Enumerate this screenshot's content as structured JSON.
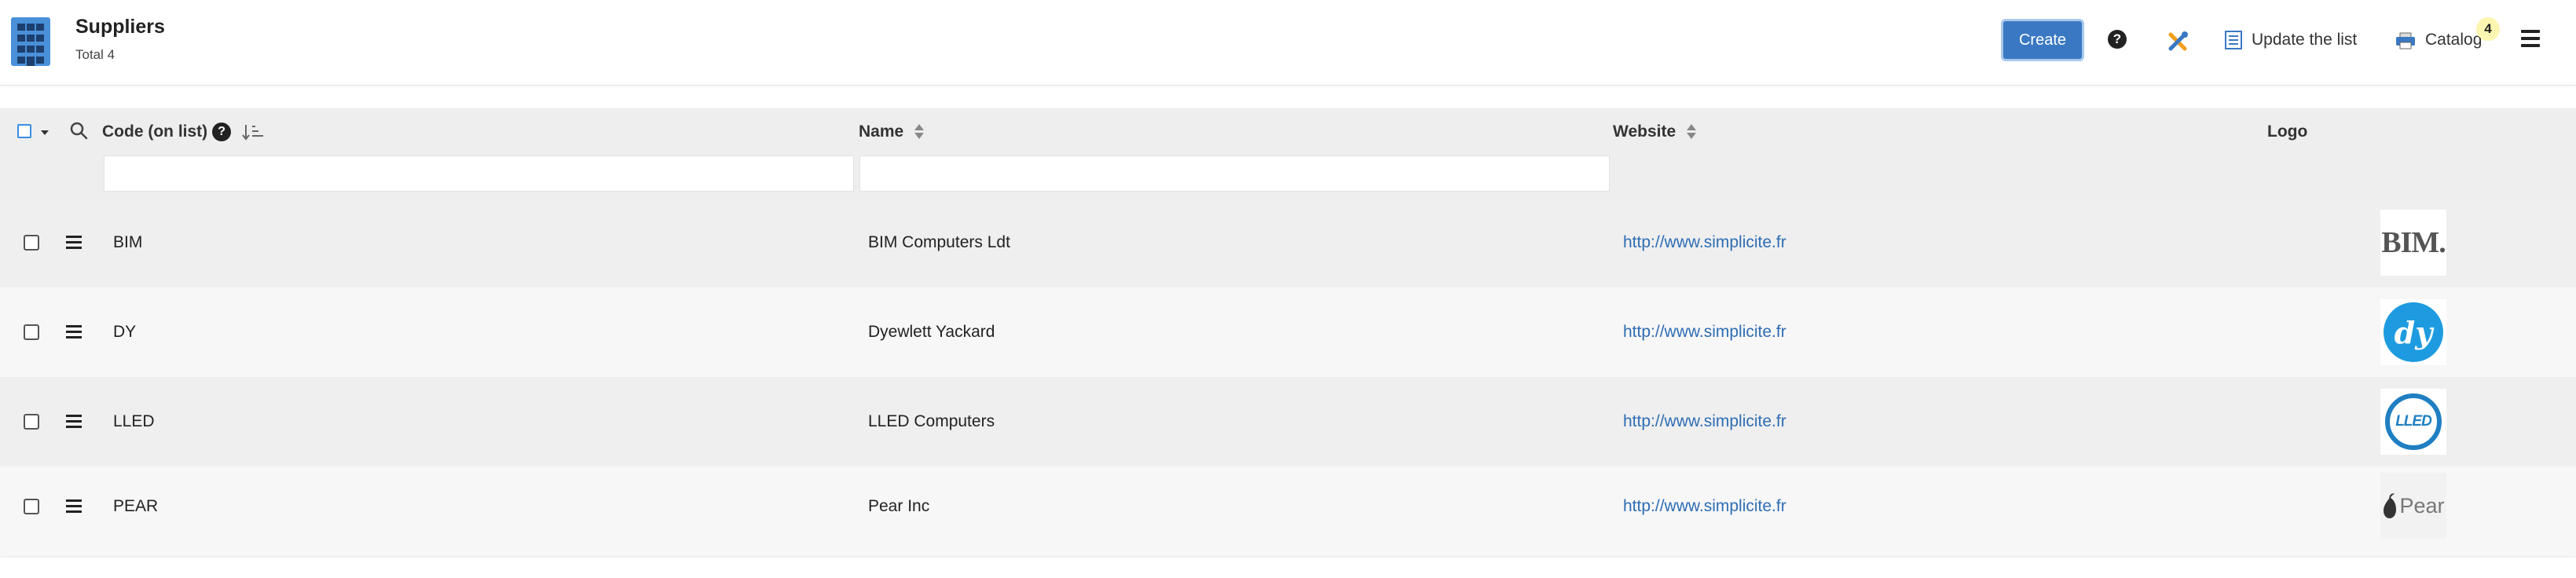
{
  "header": {
    "title": "Suppliers",
    "subtitle": "Total 4",
    "create_label": "Create",
    "help_label": "?",
    "update_label": "Update the list",
    "catalog_label": "Catalog",
    "catalog_badge": "4"
  },
  "table": {
    "columns": [
      {
        "label": "Code (on list)"
      },
      {
        "label": "Name"
      },
      {
        "label": "Website"
      },
      {
        "label": "Logo"
      }
    ],
    "help_label": "?",
    "rows": [
      {
        "code": "BIM",
        "name": "BIM Computers Ldt",
        "website": "http://www.simplicite.fr",
        "logo_text": "BIM."
      },
      {
        "code": "DY",
        "name": "Dyewlett Yackard",
        "website": "http://www.simplicite.fr",
        "logo_text": "dy"
      },
      {
        "code": "LLED",
        "name": "LLED Computers",
        "website": "http://www.simplicite.fr",
        "logo_text": "LLED"
      },
      {
        "code": "PEAR",
        "name": "Pear Inc",
        "website": "http://www.simplicite.fr",
        "logo_text": "Pear"
      }
    ]
  },
  "colors": {
    "accent": "#3a78c3",
    "link": "#2e6db4",
    "hp_blue": "#1e9be0",
    "lled_blue": "#1f7fc2"
  },
  "icons": {
    "app": "building-icon",
    "help": "help-icon",
    "tools": "tools-icon",
    "update": "list-icon",
    "catalog": "printer-icon",
    "menu": "hamburger-icon",
    "search": "search-icon",
    "sort": "sort-icon",
    "row_menu": "row-menu-icon"
  }
}
